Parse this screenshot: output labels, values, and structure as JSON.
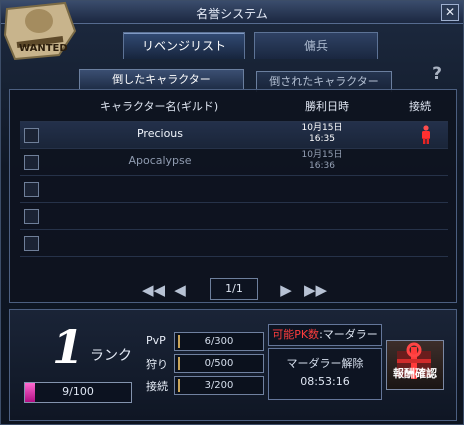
{
  "window": {
    "title": "名誉システム",
    "close_symbol": "✕"
  },
  "tabs": {
    "main": [
      "リベンジリスト",
      "傭兵"
    ],
    "sub": [
      "倒したキャラクター",
      "倒されたキャラクター"
    ]
  },
  "help_symbol": "?",
  "table": {
    "headers": {
      "name": "キャラクター名(ギルド)",
      "date": "勝利日時",
      "connection": "接続"
    },
    "rows": [
      {
        "name": "Precious",
        "date": "10月15日",
        "time": "16:35",
        "online": true
      },
      {
        "name": "Apocalypse",
        "date": "10月15日",
        "time": "16:36",
        "online": false
      },
      {
        "name": "",
        "date": "",
        "time": "",
        "online": false
      },
      {
        "name": "",
        "date": "",
        "time": "",
        "online": false
      },
      {
        "name": "",
        "date": "",
        "time": "",
        "online": false
      }
    ]
  },
  "pager": {
    "first": "◀◀",
    "prev": "◀",
    "page": "1/1",
    "next": "▶",
    "last": "▶▶"
  },
  "rank": {
    "number": "1",
    "label": "ランク",
    "progress_text": "9/100",
    "progress_fraction": 0.09
  },
  "stats": [
    {
      "label": "PvP",
      "value": "6/300"
    },
    {
      "label": "狩り",
      "value": "0/500"
    },
    {
      "label": "接続",
      "value": "3/200"
    }
  ],
  "pk": {
    "label": "可能PK数",
    "value": ":マーダラー"
  },
  "murder_release": {
    "label": "マーダラー解除",
    "time": "08:53:16"
  },
  "reward": {
    "label": "報酬確認"
  },
  "colors": {
    "accent": "#ff3d3d",
    "progress": "#e23aa9"
  }
}
